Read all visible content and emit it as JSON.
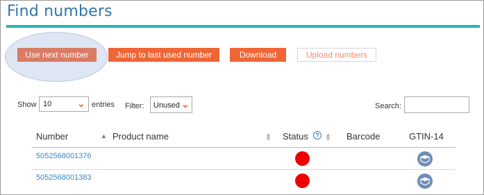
{
  "page": {
    "title": "Find numbers"
  },
  "actions": {
    "use_next": "Use next number",
    "jump_last": "Jump to last used number",
    "download": "Download",
    "upload": "Upload numbers"
  },
  "controls": {
    "show_label": "Show",
    "entries_value": "10",
    "entries_label": "entries",
    "filter_label": "Filter:",
    "filter_value": "Unused",
    "search_label": "Search:",
    "search_value": ""
  },
  "table": {
    "columns": [
      "Number",
      "Product name",
      "Status",
      "Barcode",
      "GTIN-14"
    ],
    "rows": [
      {
        "number": "5052568001376",
        "product_name": "",
        "status": "red",
        "barcode": "",
        "gtin14": "box-icon"
      },
      {
        "number": "5052568001383",
        "product_name": "",
        "status": "red",
        "barcode": "",
        "gtin14": "box-icon"
      }
    ]
  },
  "colors": {
    "title": "#2f76a8",
    "accent_bar": "#28b3b1",
    "primary_button": "#ef6536",
    "link": "#3a85c0",
    "status_red": "#ee0000"
  }
}
